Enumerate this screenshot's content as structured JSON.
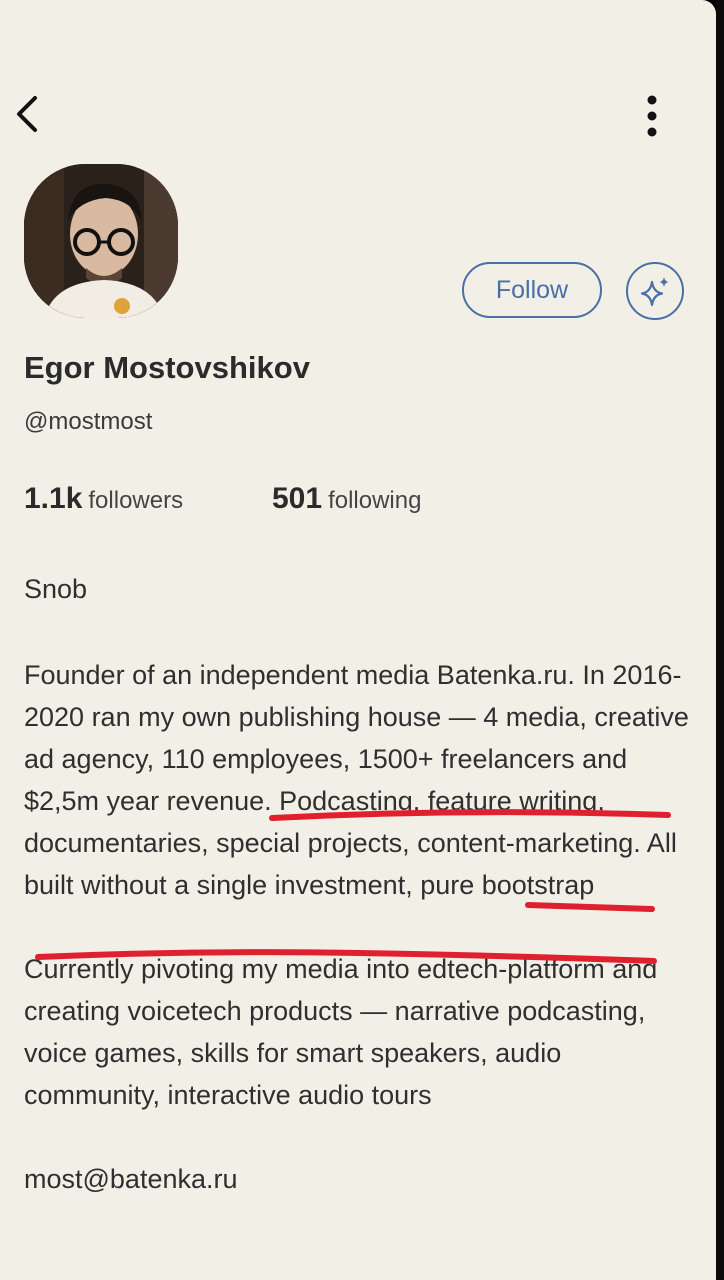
{
  "header": {
    "back_icon": "chevron-left-icon",
    "more_icon": "more-vertical-icon"
  },
  "profile": {
    "name": "Egor Mostovshikov",
    "handle": "@mostmost",
    "follow_label": "Follow",
    "sparkle_icon": "sparkle-icon",
    "followers_count": "1.1k",
    "followers_label": "followers",
    "following_count": "501",
    "following_label": "following",
    "bio_title": "Snob",
    "bio_paragraph_1": "Founder of an independent media Batenka.ru. In 2016-2020 ran my own publishing house — 4 media, creative ad agency, 110 employees, 1500+ freelancers and $2,5m year revenue. Podcasting, feature writing, documentaries, special projects, content-marketing. All built without a single investment, pure bootstrap",
    "bio_paragraph_2": "Currently pivoting my media into edtech-platform and creating voicetech products — narrative podcasting, voice games, skills for smart speakers, audio community, interactive audio tours",
    "email": "most@batenka.ru"
  },
  "colors": {
    "background": "#f2efe6",
    "accent": "#4a6ea8",
    "annotation": "#e0202e"
  }
}
